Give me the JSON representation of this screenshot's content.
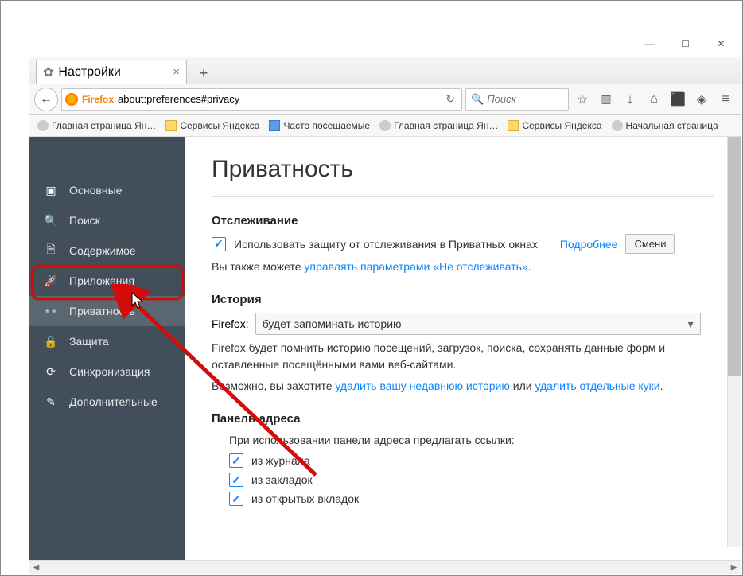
{
  "window": {
    "title_tab": "Настройки"
  },
  "nav": {
    "firefox_label": "Firefox",
    "url": "about:preferences#privacy",
    "search_placeholder": "Поиск"
  },
  "bookmarks": [
    {
      "icon": "g",
      "label": "Главная страница Ян…"
    },
    {
      "icon": "y",
      "label": "Сервисы Яндекса"
    },
    {
      "icon": "b",
      "label": "Часто посещаемые"
    },
    {
      "icon": "g",
      "label": "Главная страница Ян…"
    },
    {
      "icon": "y",
      "label": "Сервисы Яндекса"
    },
    {
      "icon": "g",
      "label": "Начальная страница"
    }
  ],
  "sidebar": {
    "items": [
      {
        "label": "Основные"
      },
      {
        "label": "Поиск"
      },
      {
        "label": "Содержимое"
      },
      {
        "label": "Приложения"
      },
      {
        "label": "Приватность"
      },
      {
        "label": "Защита"
      },
      {
        "label": "Синхронизация"
      },
      {
        "label": "Дополнительные"
      }
    ]
  },
  "page": {
    "heading": "Приватность",
    "tracking": {
      "title": "Отслеживание",
      "checkbox_label": "Использовать защиту от отслеживания в Приватных окнах",
      "learn_more": "Подробнее",
      "change_btn": "Смени",
      "also_prefix": "Вы также можете ",
      "also_link": "управлять параметрами «Не отслеживать»",
      "also_suffix": "."
    },
    "history": {
      "title": "История",
      "label": "Firefox:",
      "select_value": "будет запоминать историю",
      "desc": "Firefox будет помнить историю посещений, загрузок, поиска, сохранять данные форм и оставленные посещёнными вами веб-сайтами.",
      "maybe_prefix": "Возможно, вы захотите ",
      "del_history": "удалить вашу недавнюю историю",
      "maybe_middle": " или ",
      "del_cookies": "удалить отдельные куки",
      "maybe_suffix": "."
    },
    "addressbar": {
      "title": "Панель адреса",
      "desc": "При использовании панели адреса предлагать ссылки:",
      "opt1": "из журнала",
      "opt2": "из закладок",
      "opt3": "из открытых вкладок"
    }
  }
}
